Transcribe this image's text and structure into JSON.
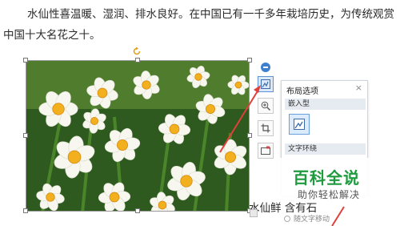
{
  "document": {
    "paragraph_1": "水仙性喜温暖、湿润、排水良好。在中国已有一千多年栽培历史，为传统观赏",
    "paragraph_2": "中国十大名花之十。",
    "paragraph_3": "水仙鲜                 含有石"
  },
  "image": {
    "subject": "narcissus flowers",
    "alt": "水仙花"
  },
  "side_toolbar": {
    "items": [
      {
        "name": "collapse",
        "icon": "minus-circle-icon"
      },
      {
        "name": "layout-options",
        "icon": "layout-icon"
      },
      {
        "name": "zoom",
        "icon": "zoom-in-icon"
      },
      {
        "name": "crop",
        "icon": "crop-icon"
      },
      {
        "name": "chart",
        "icon": "image-frame-icon"
      }
    ]
  },
  "layout_panel": {
    "title": "布局选项",
    "close": "×",
    "section_inline": "嵌入型",
    "section_wrap": "文字环绕",
    "radio_label": "随文字移动"
  },
  "watermark": {
    "title": "百科全说",
    "subtitle": "助你轻松解决"
  },
  "colors": {
    "accent": "#3f7fd0",
    "annotation_arrow": "#e0403a",
    "watermark_green": "#1f9a3f"
  }
}
